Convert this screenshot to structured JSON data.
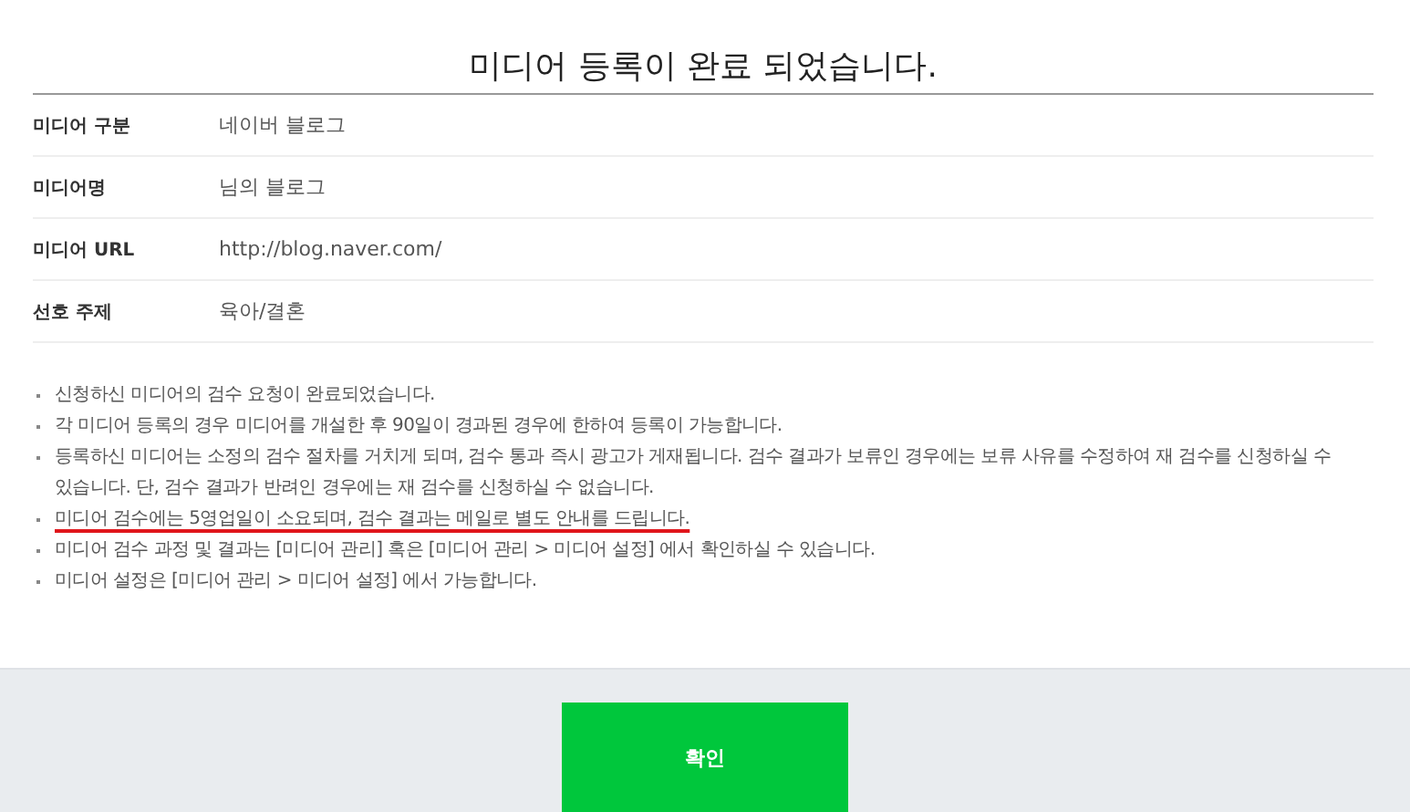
{
  "title": "미디어 등록이 완료 되었습니다.",
  "details": [
    {
      "label": "미디어 구분",
      "value": "네이버 블로그"
    },
    {
      "label": "미디어명",
      "value": "님의 블로그"
    },
    {
      "label": "미디어 URL",
      "value": "http://blog.naver.com/"
    },
    {
      "label": "선호 주제",
      "value": "육아/결혼"
    }
  ],
  "notes": [
    {
      "text": "신청하신 미디어의 검수 요청이 완료되었습니다.",
      "underlined": false
    },
    {
      "text": "각 미디어 등록의 경우 미디어를 개설한 후 90일이 경과된 경우에 한하여 등록이 가능합니다.",
      "underlined": false
    },
    {
      "text": "등록하신 미디어는 소정의 검수 절차를 거치게 되며, 검수 통과 즉시 광고가 게재됩니다. 검수 결과가 보류인 경우에는 보류 사유를 수정하여 재 검수를 신청하실 수 있습니다. 단, 검수 결과가 반려인 경우에는 재 검수를 신청하실 수 없습니다.",
      "underlined": false
    },
    {
      "text": "미디어 검수에는 5영업일이 소요되며, 검수 결과는 메일로 별도 안내를 드립니다.",
      "underlined": true
    },
    {
      "text": "미디어 검수 과정 및 결과는 [미디어 관리] 혹은 [미디어 관리 > 미디어 설정] 에서 확인하실 수 있습니다.",
      "underlined": false
    },
    {
      "text": "미디어 설정은 [미디어 관리 > 미디어 설정] 에서 가능합니다.",
      "underlined": false
    }
  ],
  "confirm_button": "확인"
}
